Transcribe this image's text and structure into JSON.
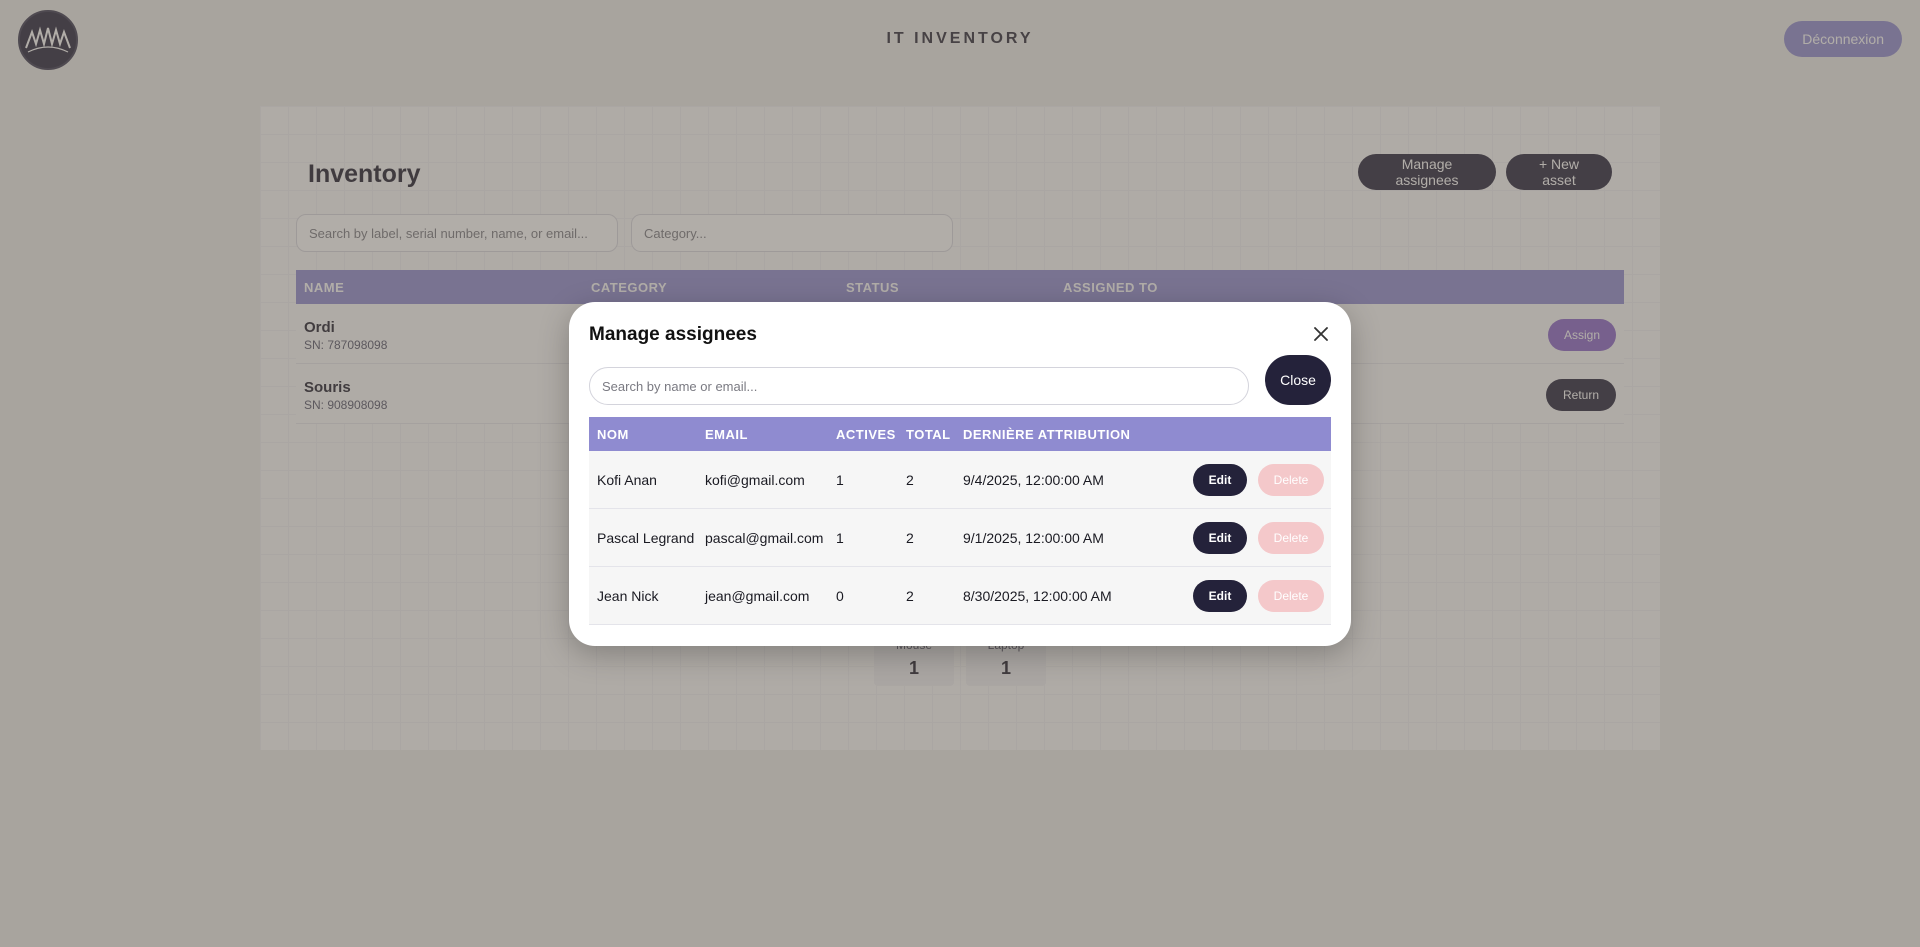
{
  "header": {
    "app_title": "IT INVENTORY",
    "logout_label": "Déconnexion"
  },
  "inventory": {
    "title": "Inventory",
    "manage_assignees_label": "Manage assignees",
    "new_asset_label": "+ New asset",
    "search_placeholder": "Search by label, serial number, name, or email...",
    "category_placeholder": "Category...",
    "columns": [
      "NAME",
      "CATEGORY",
      "STATUS",
      "ASSIGNED TO"
    ],
    "rows": [
      {
        "name": "Ordi",
        "serial": "SN: 787098098",
        "action": "Assign"
      },
      {
        "name": "Souris",
        "serial": "SN: 908908098",
        "action": "Return"
      }
    ],
    "stats": [
      {
        "label": "Mouse",
        "value": "1"
      },
      {
        "label": "Laptop",
        "value": "1"
      }
    ]
  },
  "modal": {
    "title": "Manage assignees",
    "search_placeholder": "Search by name or email...",
    "close_label": "Close",
    "columns": [
      "NOM",
      "EMAIL",
      "ACTIVES",
      "TOTAL",
      "DERNIÈRE ATTRIBUTION"
    ],
    "rows": [
      {
        "nom": "Kofi Anan",
        "email": "kofi@gmail.com",
        "actives": "1",
        "total": "2",
        "last": "9/4/2025, 12:00:00 AM",
        "edit": "Edit",
        "delete": "Delete"
      },
      {
        "nom": "Pascal Legrand",
        "email": "pascal@gmail.com",
        "actives": "1",
        "total": "2",
        "last": "9/1/2025, 12:00:00 AM",
        "edit": "Edit",
        "delete": "Delete"
      },
      {
        "nom": "Jean Nick",
        "email": "jean@gmail.com",
        "actives": "0",
        "total": "2",
        "last": "8/30/2025, 12:00:00 AM",
        "edit": "Edit",
        "delete": "Delete"
      }
    ]
  },
  "colors": {
    "accent": "#8f8bd0",
    "dark": "#24223a",
    "assign": "#8a64c8",
    "delete_disabled": "#f4c8ca"
  },
  "icons": {
    "logo": "brand-logo-icon",
    "close": "close-icon"
  }
}
